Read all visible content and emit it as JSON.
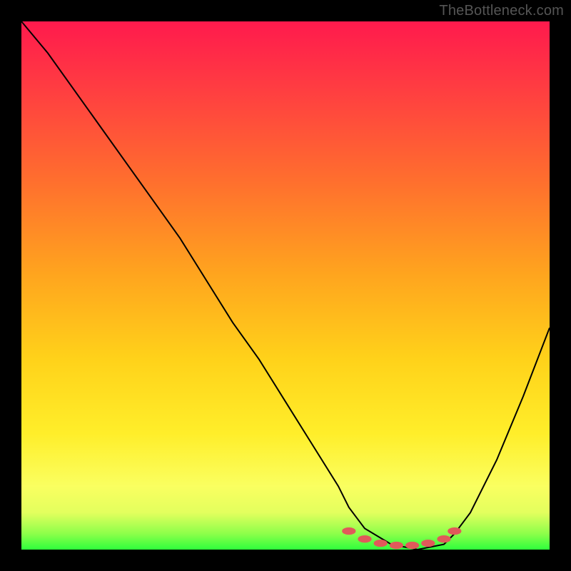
{
  "watermark": "TheBottleneck.com",
  "chart_data": {
    "type": "line",
    "title": "",
    "xlabel": "",
    "ylabel": "",
    "xlim": [
      0,
      100
    ],
    "ylim": [
      0,
      100
    ],
    "gradient_colors": {
      "top": "#ff1a4d",
      "mid_upper": "#ff6e2e",
      "mid": "#ffd21a",
      "mid_lower": "#faff60",
      "bottom": "#2fff3c"
    },
    "series": [
      {
        "name": "bottleneck-curve",
        "color": "#000000",
        "x": [
          0,
          5,
          10,
          15,
          20,
          25,
          30,
          35,
          40,
          45,
          50,
          55,
          60,
          62,
          65,
          70,
          75,
          80,
          82,
          85,
          90,
          95,
          100
        ],
        "y": [
          100,
          94,
          87,
          80,
          73,
          66,
          59,
          51,
          43,
          36,
          28,
          20,
          12,
          8,
          4,
          1,
          0,
          1,
          3,
          7,
          17,
          29,
          42
        ]
      }
    ],
    "markers": {
      "name": "optimal-range-dots",
      "color": "#e05a5a",
      "x": [
        62,
        65,
        68,
        71,
        74,
        77,
        80,
        82
      ],
      "y": [
        3.5,
        2.0,
        1.2,
        0.8,
        0.8,
        1.2,
        2.0,
        3.5
      ]
    },
    "legend": false,
    "grid": false
  }
}
